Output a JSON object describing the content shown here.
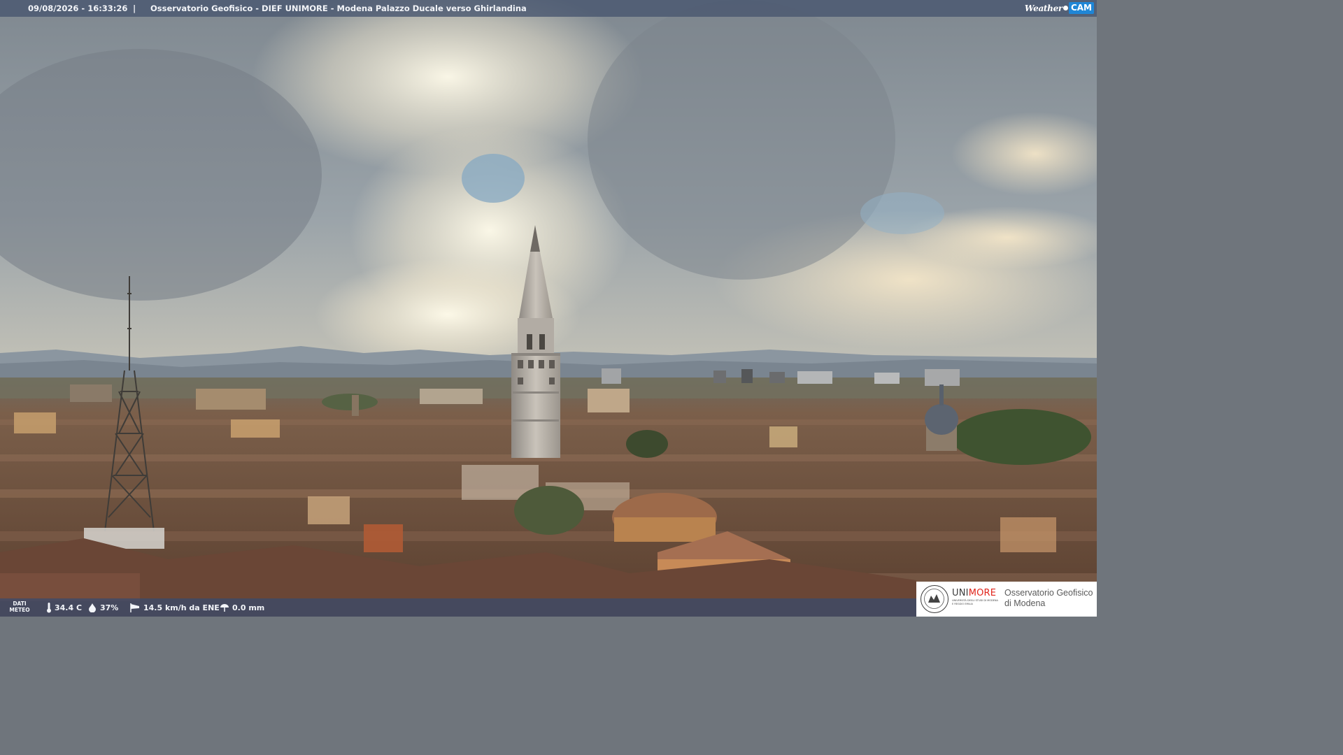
{
  "header": {
    "datetime": "09/08/2026 - 16:33:26",
    "separator": "|",
    "title": "Osservatorio Geofisico - DIEF UNIMORE - Modena Palazzo Ducale verso Ghirlandina",
    "brand_weather": "Weather",
    "brand_cam": "CAM"
  },
  "weather_bar": {
    "label": "DATI METEO",
    "temperature": "34.4 C",
    "humidity": "37%",
    "wind": "14.5 km/h da ENE",
    "rain": "0.0 mm",
    "icons": [
      "thermometer-icon",
      "humidity-drop-icon",
      "wind-sock-icon",
      "rain-gauge-icon"
    ]
  },
  "logo": {
    "uni_prefix": "UNI",
    "uni_suffix": "MORE",
    "uni_subtitle": "UNIVERSITÀ DEGLI STUDI DI MODENA E REGGIO EMILIA",
    "observatory": "Osservatorio Geofisico",
    "city": "di Modena",
    "accent": "#e1251b"
  },
  "scene": {
    "landmark": "Ghirlandina tower",
    "sky_color": "#8a949c",
    "roof_color": "#7a5a45"
  }
}
